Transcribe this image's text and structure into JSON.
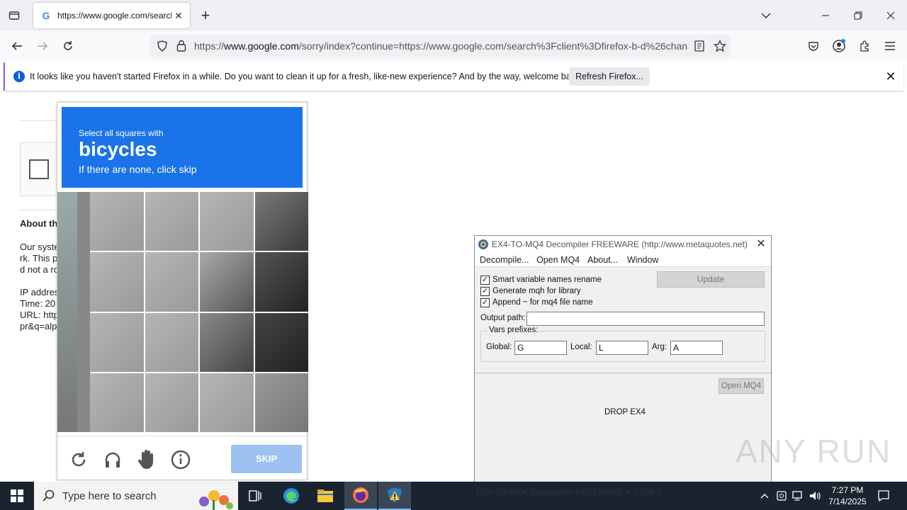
{
  "browser": {
    "tab": {
      "title": "https://www.google.com/search?",
      "favicon": "google-g-icon"
    },
    "url": {
      "prefix": "https://",
      "host": "www.google.com",
      "rest": "/sorry/index?continue=https://www.google.com/search%3Fclient%3Dfirefox-b-d%26chan"
    },
    "notification": {
      "message": "It looks like you haven't started Firefox in a while. Do you want to clean it up for a fresh, like-new experience? And by the way, welcome back!",
      "button": "Refresh Firefox..."
    }
  },
  "page": {
    "about_heading": "About th",
    "lines": [
      "Our syste",
      "rk. This p",
      "d not a ro",
      "",
      "IP addres",
      "Time: 20",
      "URL: http",
      "pr&q=alp"
    ]
  },
  "captcha": {
    "line1": "Select all squares with",
    "target": "bicycles",
    "line3": "If there are none, click skip",
    "skip": "SKIP",
    "icons": [
      "reload-icon",
      "headphones-icon",
      "hand-icon",
      "info-icon"
    ]
  },
  "ex4window": {
    "title": "EX4-TO-MQ4 Decompiler FREEWARE (http://www.metaquotes.net)",
    "menu": [
      "Decompile...",
      "Open MQ4",
      "About...",
      "Window"
    ],
    "checkboxes": [
      {
        "label": "Smart variable names rename",
        "checked": true
      },
      {
        "label": "Generate mqh for library",
        "checked": true
      },
      {
        "label": "Append ~ for mq4 file name",
        "checked": true
      }
    ],
    "update_button": "Update",
    "output_path_label": "Output path:",
    "output_path_value": "",
    "vars_prefixes_label": "Vars prefixes:",
    "global_label": "Global:",
    "global_value": "G",
    "local_label": "Local:",
    "local_value": "L",
    "arg_label": "Arg:",
    "arg_value": "A",
    "open_mq4_button": "Open MQ4",
    "drop_text": "DROP EX4",
    "status": "EX4-TO-MQ4 Decompiler FREEWARE  4.0.509.5"
  },
  "watermark": "ANY RUN",
  "taskbar": {
    "search_placeholder": "Type here to search",
    "time": "7:27 PM",
    "date": "7/14/2025"
  }
}
